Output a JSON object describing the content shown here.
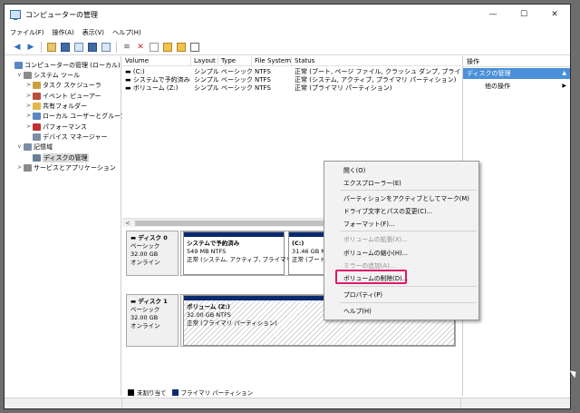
{
  "window": {
    "title": "コンピューターの管理",
    "minimize": "—",
    "maximize": "☐",
    "close": "✕"
  },
  "menubar": [
    "ファイル(F)",
    "操作(A)",
    "表示(V)",
    "ヘルプ(H)"
  ],
  "toolbar": {
    "back_icon": "arrow-left-icon",
    "forward_icon": "arrow-right-icon",
    "delete_icon": "x-icon"
  },
  "tree": [
    {
      "label": "コンピューターの管理 (ローカル)",
      "indent": 0,
      "expander": "",
      "icon_color": "#5a87c4"
    },
    {
      "label": "システム ツール",
      "indent": 1,
      "expander": "∨",
      "icon_color": "#8a8a8a"
    },
    {
      "label": "タスク スケジューラ",
      "indent": 2,
      "expander": ">",
      "icon_color": "#c9a13b"
    },
    {
      "label": "イベント ビューアー",
      "indent": 2,
      "expander": ">",
      "icon_color": "#b84e3a"
    },
    {
      "label": "共有フォルダー",
      "indent": 2,
      "expander": ">",
      "icon_color": "#e0b64a"
    },
    {
      "label": "ローカル ユーザーとグループ",
      "indent": 2,
      "expander": ">",
      "icon_color": "#5a87c4"
    },
    {
      "label": "パフォーマンス",
      "indent": 2,
      "expander": ">",
      "icon_color": "#c53030"
    },
    {
      "label": "デバイス マネージャー",
      "indent": 2,
      "expander": "",
      "icon_color": "#7b8ea8"
    },
    {
      "label": "記憶域",
      "indent": 1,
      "expander": "∨",
      "icon_color": "#7b8ea8"
    },
    {
      "label": "ディスクの管理",
      "indent": 2,
      "expander": "",
      "icon_color": "#6a7e98",
      "selected": true
    },
    {
      "label": "サービスとアプリケーション",
      "indent": 1,
      "expander": ">",
      "icon_color": "#8a8a8a"
    }
  ],
  "volumes": {
    "columns": [
      "Volume",
      "Layout",
      "Type",
      "File System",
      "Status"
    ],
    "rows": [
      [
        "(C:)",
        "シンプル",
        "ベーシック",
        "NTFS",
        "正常 (ブート, ページ ファイル, クラッシュ ダンプ, プライマリ パーティ"
      ],
      [
        "システムで予約済み",
        "シンプル",
        "ベーシック",
        "NTFS",
        "正常 (システム, アクティブ, プライマリ パーティション)"
      ],
      [
        "ボリューム (Z:)",
        "シンプル",
        "ベーシック",
        "NTFS",
        "正常 (プライマリ パーティション)"
      ]
    ]
  },
  "disks": [
    {
      "name": "ディスク 0",
      "type": "ベーシック",
      "size": "32.00 GB",
      "state": "オンライン",
      "partitions": [
        {
          "name": "システムで予約済み",
          "size": "549 MB NTFS",
          "status": "正常 (システム, アクティブ, プライマリ パ"
        },
        {
          "name": "(C:)",
          "size": "31.46 GB NT",
          "status": "正常 (ブート,"
        }
      ]
    },
    {
      "name": "ディスク 1",
      "type": "ベーシック",
      "size": "32.00 GB",
      "state": "オンライン",
      "partitions": [
        {
          "name": "ボリューム (Z:)",
          "size": "32.00 GB NTFS",
          "status": "正常 (プライマリ パーティション)"
        }
      ]
    }
  ],
  "legend": {
    "unallocated": "未割り当て",
    "primary": "プライマリ パーティション",
    "unallocated_color": "#000000",
    "primary_color": "#0b2a6f"
  },
  "actions": {
    "title": "操作",
    "section": "ディスクの管理",
    "item": "他の操作",
    "section_color": "#4a90d9"
  },
  "context_menu": {
    "items": [
      {
        "label": "開く(O)",
        "disabled": false
      },
      {
        "label": "エクスプローラー(E)",
        "disabled": false
      },
      {
        "label": "パーティションをアクティブとしてマーク(M)",
        "disabled": false
      },
      {
        "label": "ドライブ文字とパスの変更(C)...",
        "disabled": false
      },
      {
        "label": "フォーマット(F)...",
        "disabled": false
      },
      {
        "label": "ボリュームの拡張(X)...",
        "disabled": true
      },
      {
        "label": "ボリュームの縮小(H)...",
        "disabled": false
      },
      {
        "label": "ミラーの追加(A)...",
        "disabled": true
      },
      {
        "label": "ボリュームの削除(D)...",
        "disabled": false,
        "highlighted": true
      },
      {
        "label": "プロパティ(P)",
        "disabled": false
      },
      {
        "label": "ヘルプ(H)",
        "disabled": false
      }
    ],
    "highlight_color": "#e2166b"
  }
}
